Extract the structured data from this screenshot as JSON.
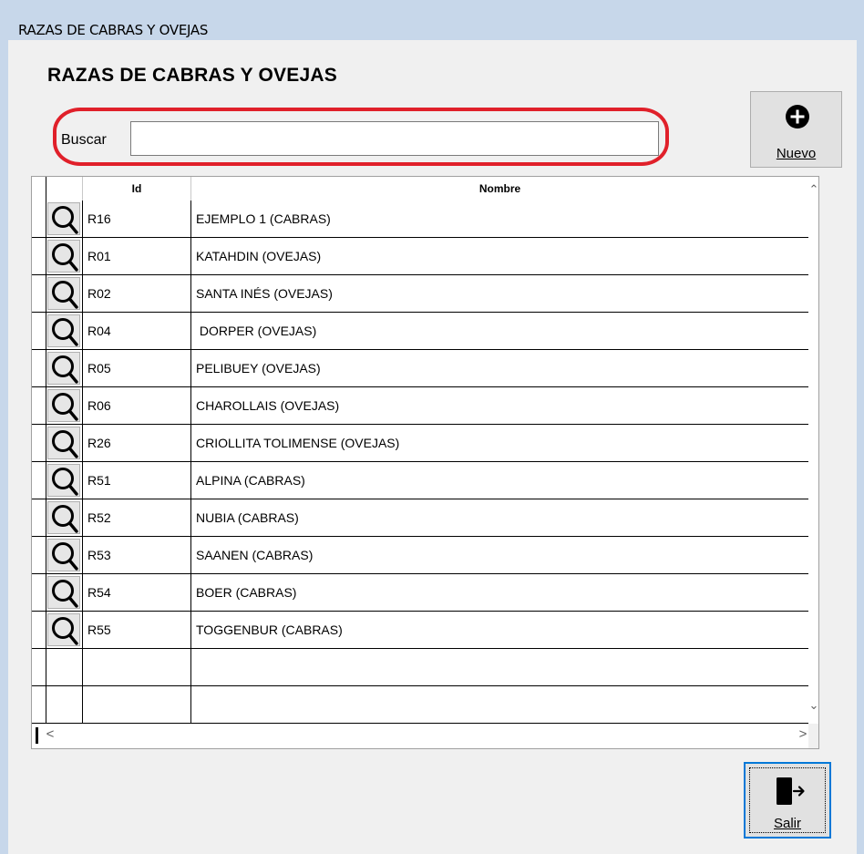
{
  "window": {
    "title": "RAZAS DE CABRAS Y OVEJAS"
  },
  "heading": "RAZAS DE CABRAS Y OVEJAS",
  "search": {
    "label": "Buscar",
    "value": "",
    "highlight_color": "#e0202a"
  },
  "buttons": {
    "new": {
      "label": "Nuevo",
      "icon": "plus-circle-icon"
    },
    "exit": {
      "label": "Salir",
      "icon": "exit-door-icon"
    }
  },
  "grid": {
    "columns": [
      "Id",
      "Nombre"
    ],
    "rows": [
      {
        "id": "R16",
        "nombre": "EJEMPLO 1 (CABRAS)"
      },
      {
        "id": "R01",
        "nombre": "KATAHDIN (OVEJAS)"
      },
      {
        "id": "R02",
        "nombre": "SANTA INÉS (OVEJAS)"
      },
      {
        "id": "R04",
        "nombre": " DORPER (OVEJAS)"
      },
      {
        "id": "R05",
        "nombre": "PELIBUEY (OVEJAS)"
      },
      {
        "id": "R06",
        "nombre": "CHAROLLAIS (OVEJAS)"
      },
      {
        "id": "R26",
        "nombre": "CRIOLLITA TOLIMENSE (OVEJAS)"
      },
      {
        "id": "R51",
        "nombre": "ALPINA (CABRAS)"
      },
      {
        "id": "R52",
        "nombre": "NUBIA (CABRAS)"
      },
      {
        "id": "R53",
        "nombre": "SAANEN (CABRAS)"
      },
      {
        "id": "R54",
        "nombre": "BOER (CABRAS)"
      },
      {
        "id": "R55",
        "nombre": "TOGGENBUR (CABRAS)"
      }
    ],
    "empty_rows": 2,
    "view_icon": "magnifier-icon"
  },
  "scrollbars": {
    "up": "⌃",
    "down": "⌄",
    "left": "<",
    "right": ">"
  }
}
